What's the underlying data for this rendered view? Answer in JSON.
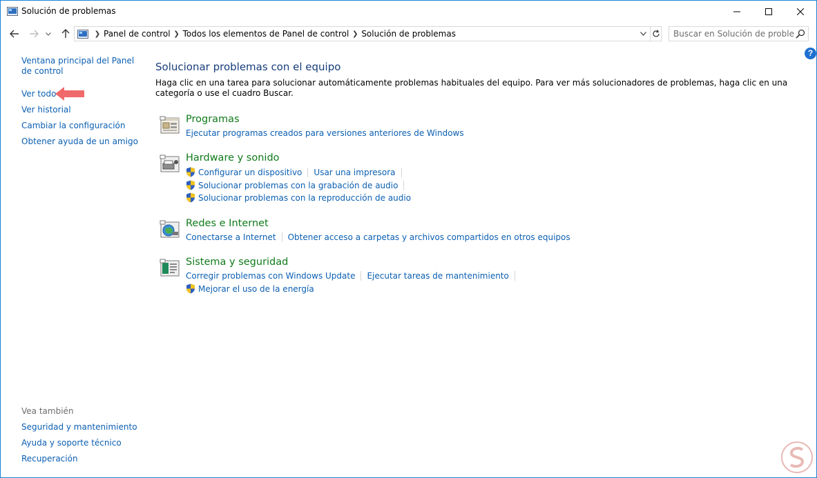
{
  "window": {
    "title": "Solución de problemas"
  },
  "address": {
    "crumbs": [
      "Panel de control",
      "Todos los elementos de Panel de control",
      "Solución de problemas"
    ]
  },
  "search": {
    "placeholder": "Buscar en Solución de proble"
  },
  "help": {
    "label": "?"
  },
  "left_pane": {
    "home": "Ventana principal del Panel de control",
    "view_all": "Ver todo",
    "history": "Ver historial",
    "settings": "Cambiar la configuración",
    "friend": "Obtener ayuda de un amigo",
    "see_also_heading": "Vea también",
    "see_also": [
      "Seguridad y mantenimiento",
      "Ayuda y soporte técnico",
      "Recuperación"
    ]
  },
  "main": {
    "title": "Solucionar problemas con el equipo",
    "description": "Haga clic en una tarea para solucionar automáticamente problemas habituales del equipo. Para ver más solucionadores de problemas, haga clic en una categoría o use el cuadro Buscar.",
    "categories": {
      "programs": {
        "title": "Programas",
        "task1": "Ejecutar programas creados para versiones anteriores de Windows"
      },
      "hardware": {
        "title": "Hardware y sonido",
        "task1": "Configurar un dispositivo",
        "task2": "Usar una impresora",
        "task3": "Solucionar problemas con la grabación de audio",
        "task4": "Solucionar problemas con la reproducción de audio"
      },
      "network": {
        "title": "Redes e Internet",
        "task1": "Conectarse a Internet",
        "task2": "Obtener acceso a carpetas y archivos compartidos en otros equipos"
      },
      "system": {
        "title": "Sistema y seguridad",
        "task1": "Corregir problemas con Windows Update",
        "task2": "Ejecutar tareas de mantenimiento",
        "task3": "Mejorar el uso de la energía"
      }
    }
  },
  "colors": {
    "link": "#0b5fb2",
    "category_title": "#0f7a1a",
    "window_border": "#1883d7",
    "arrow": "#f0696b"
  }
}
